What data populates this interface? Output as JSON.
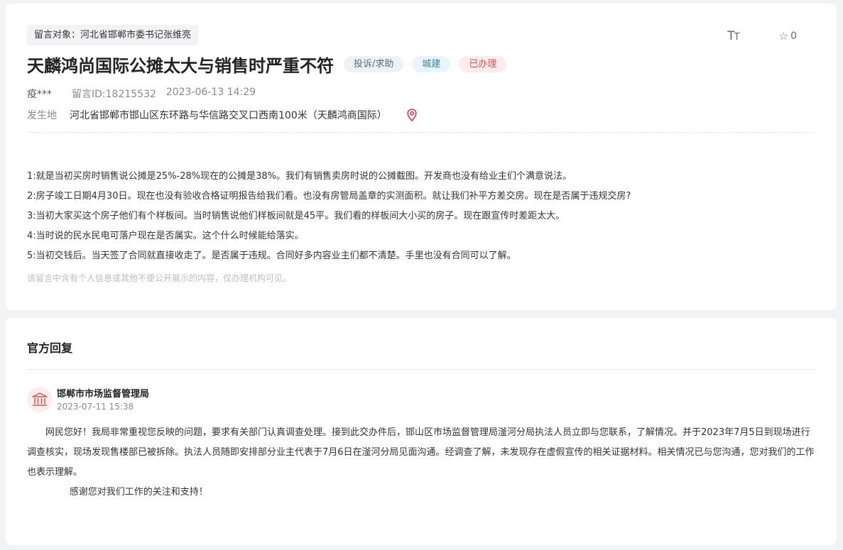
{
  "post": {
    "target": "留言对象：河北省邯郸市委书记张维亮",
    "title": "天麟鸿尚国际公摊太大与销售时严重不符",
    "tags": {
      "type": "投诉/求助",
      "category": "城建",
      "status": "已办理"
    },
    "author": "疫***",
    "message_id": "留言ID:18215532",
    "time": "2023-06-13 14:29",
    "location_label": "发生地",
    "location": "河北省邯郸市邯山区东环路与华信路交叉口西南100米（天麟鸿商国际）",
    "content": [
      "1:就是当初买房时销售说公摊是25%-28%现在的公摊是38%。我们有销售卖房时说的公摊截图。开发商也没有给业主们个满意说法。",
      "2:房子竣工日期4月30日。现在也没有验收合格证明报告给我们看。也没有房管局盖章的实测面积。就让我们补平方差交房。现在是否属于违规交房?",
      "3:当初大家买这个房子他们有个样板间。当时销售说他们样板间就是45平。我们看的样板间大小买的房子。现在跟宣传时差距太大。",
      "4:当时说的民水民电可落户现在是否属实。这个什么时候能给落实。",
      "5:当初交钱后。当天签了合同就直接收走了。是否属于违规。合同好多内容业主们都不清楚。手里也没有合同可以了解。"
    ],
    "privacy_note": "该留言中含有个人信息或其他不便公开展示的内容，仅办理机构可见。"
  },
  "toolbar": {
    "font_icon_large": "T",
    "font_icon_small": "T",
    "favorite_icon": "star-outline-icon",
    "favorite_count": "0"
  },
  "reply": {
    "section_title": "官方回复",
    "department": "邯郸市市场监督管理局",
    "time": "2023-07-11 15:38",
    "paragraph1": "网民您好！我局非常重视您反映的问题，要求有关部门认真调查处理。接到此交办件后，邯山区市场监督管理局滏河分局执法人员立即与您联系，了解情况。并于2023年7月5日到现场进行调查核实，现场发现售楼部已被拆除。执法人员随即安排部分业主代表于7月6日在滏河分局见面沟通。经调查了解，未发现存在虚假宣传的相关证据材料。相关情况已与您沟通，您对我们的工作也表示理解。",
    "paragraph2": "感谢您对我们工作的关注和支持！"
  },
  "colors": {
    "accent_red": "#e8334a",
    "status_red": "#d9534f",
    "tag_blue": "#3f7fa6",
    "background": "#f2f3f5"
  }
}
